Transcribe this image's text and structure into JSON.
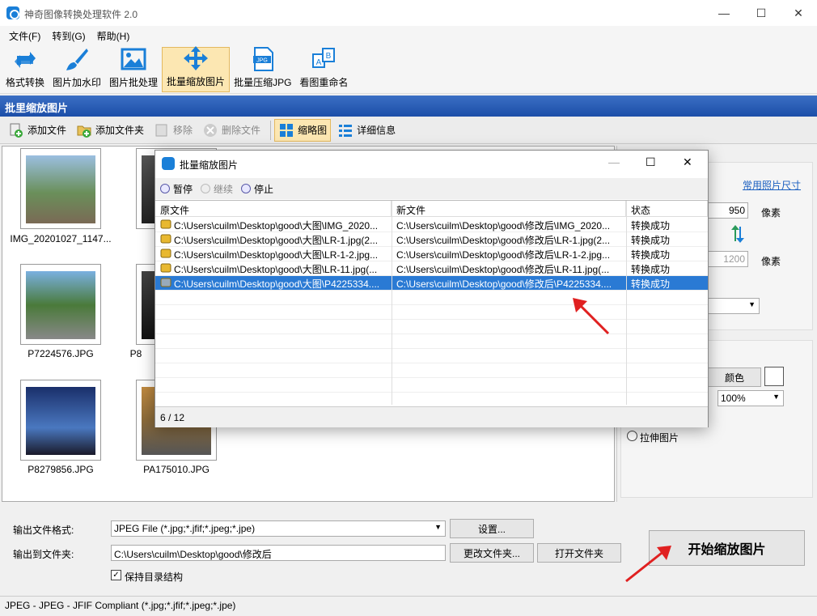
{
  "window": {
    "title": "神奇图像转换处理软件 2.0"
  },
  "menu": [
    "文件(F)",
    "转到(G)",
    "帮助(H)"
  ],
  "toolbar": [
    {
      "label": "格式转换",
      "icon": "refresh-icon"
    },
    {
      "label": "图片加水印",
      "icon": "brush-icon"
    },
    {
      "label": "图片批处理",
      "icon": "picture-icon"
    },
    {
      "label": "批量缩放图片",
      "icon": "move-arrows-icon",
      "active": true
    },
    {
      "label": "批量压缩JPG",
      "icon": "jpg-file-icon"
    },
    {
      "label": "看图重命名",
      "icon": "rename-icon"
    }
  ],
  "section_title": "批里缩放图片",
  "subtoolbar": {
    "add_file": "添加文件",
    "add_folder": "添加文件夹",
    "remove": "移除",
    "delete_file": "删除文件",
    "thumbnail": "缩略图",
    "details": "详细信息"
  },
  "thumbnails": [
    {
      "name": "IMG_20201027_1147..."
    },
    {
      "name": "P7224576.JPG"
    },
    {
      "name": "P8"
    },
    {
      "name": "P8279856.JPG"
    },
    {
      "name": "PA175010.JPG"
    }
  ],
  "right_panel": {
    "preset_link": "常用照片尺寸",
    "width_value": "950",
    "height_value": "1200",
    "unit1": "像素",
    "unit2": "像素",
    "color_btn": "颜色",
    "opacity": "100%",
    "stretch": "拉伸图片"
  },
  "dialog": {
    "title": "批量缩放图片",
    "pause": "暂停",
    "resume": "继续",
    "stop": "停止",
    "columns": [
      "原文件",
      "新文件",
      "状态"
    ],
    "rows": [
      {
        "src": "C:\\Users\\cuilm\\Desktop\\good\\大图\\IMG_2020...",
        "dst": "C:\\Users\\cuilm\\Desktop\\good\\修改后\\IMG_2020...",
        "status": "转换成功"
      },
      {
        "src": "C:\\Users\\cuilm\\Desktop\\good\\大图\\LR-1.jpg(2...",
        "dst": "C:\\Users\\cuilm\\Desktop\\good\\修改后\\LR-1.jpg(2...",
        "status": "转换成功"
      },
      {
        "src": "C:\\Users\\cuilm\\Desktop\\good\\大图\\LR-1-2.jpg...",
        "dst": "C:\\Users\\cuilm\\Desktop\\good\\修改后\\LR-1-2.jpg...",
        "status": "转换成功"
      },
      {
        "src": "C:\\Users\\cuilm\\Desktop\\good\\大图\\LR-11.jpg(...",
        "dst": "C:\\Users\\cuilm\\Desktop\\good\\修改后\\LR-11.jpg(...",
        "status": "转换成功"
      },
      {
        "src": "C:\\Users\\cuilm\\Desktop\\good\\大图\\P4225334....",
        "dst": "C:\\Users\\cuilm\\Desktop\\good\\修改后\\P4225334....",
        "status": "转换成功",
        "selected": true
      }
    ],
    "progress": "6 / 12"
  },
  "bottom": {
    "format_label": "输出文件格式:",
    "format_value": "JPEG File (*.jpg;*.jfif;*.jpeg;*.jpe)",
    "settings_btn": "设置...",
    "folder_label": "输出到文件夹:",
    "folder_value": "C:\\Users\\cuilm\\Desktop\\good\\修改后",
    "change_folder_btn": "更改文件夹...",
    "open_folder_btn": "打开文件夹",
    "keep_structure": "保持目录结构",
    "start_btn": "开始缩放图片"
  },
  "statusbar": "JPEG - JPEG - JFIF Compliant (*.jpg;*.jfif;*.jpeg;*.jpe)",
  "colors": {
    "accent": "#1c4ea8",
    "selected_row": "#2a7ad4",
    "active_tool": "#fce7b2",
    "arrow": "#e02020"
  }
}
